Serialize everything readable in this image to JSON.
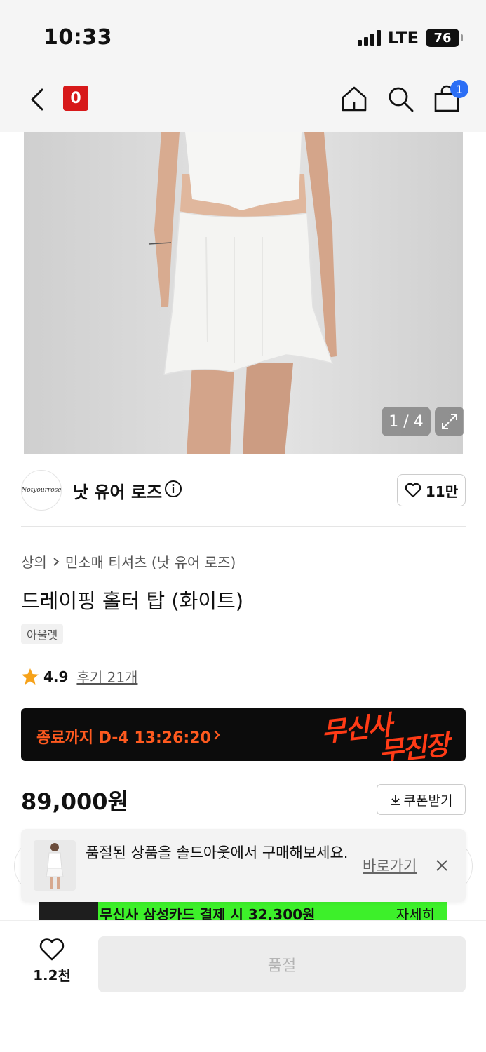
{
  "status_bar": {
    "time": "10:33",
    "network": "LTE",
    "battery": "76"
  },
  "nav": {
    "logo_text": "0",
    "cart_badge": "1"
  },
  "gallery": {
    "counter": "1 / 4"
  },
  "brand": {
    "name": "낫 유어 로즈",
    "logo_text": "Notyourrose",
    "likes": "11만"
  },
  "product": {
    "breadcrumb": [
      "상의",
      "민소매 티셔츠 (낫 유어 로즈)"
    ],
    "title": "드레이핑 홀터 탑 (화이트)",
    "tag": "아울렛",
    "rating": "4.9",
    "reviews": "후기 21개",
    "price": "89,000원",
    "coupon_label": "쿠폰받기"
  },
  "promo": {
    "countdown": "종료까지 D-4 13:26:20",
    "logo_line1": "무신사",
    "logo_line2": "무진장"
  },
  "card_offer": {
    "text": "무신사 삼성카드 결제 시 32,300원",
    "more": "자세히"
  },
  "toast": {
    "text": "품절된 상품을 솔드아웃에서 구매해보세요.",
    "link": "바로가기"
  },
  "bottom_bar": {
    "wish_count": "1.2천",
    "buy_label": "품절"
  },
  "colors": {
    "accent": "#ff3b16",
    "badge": "#2b6ef5",
    "logo_red": "#d7191a",
    "card_green": "#3df02a"
  }
}
